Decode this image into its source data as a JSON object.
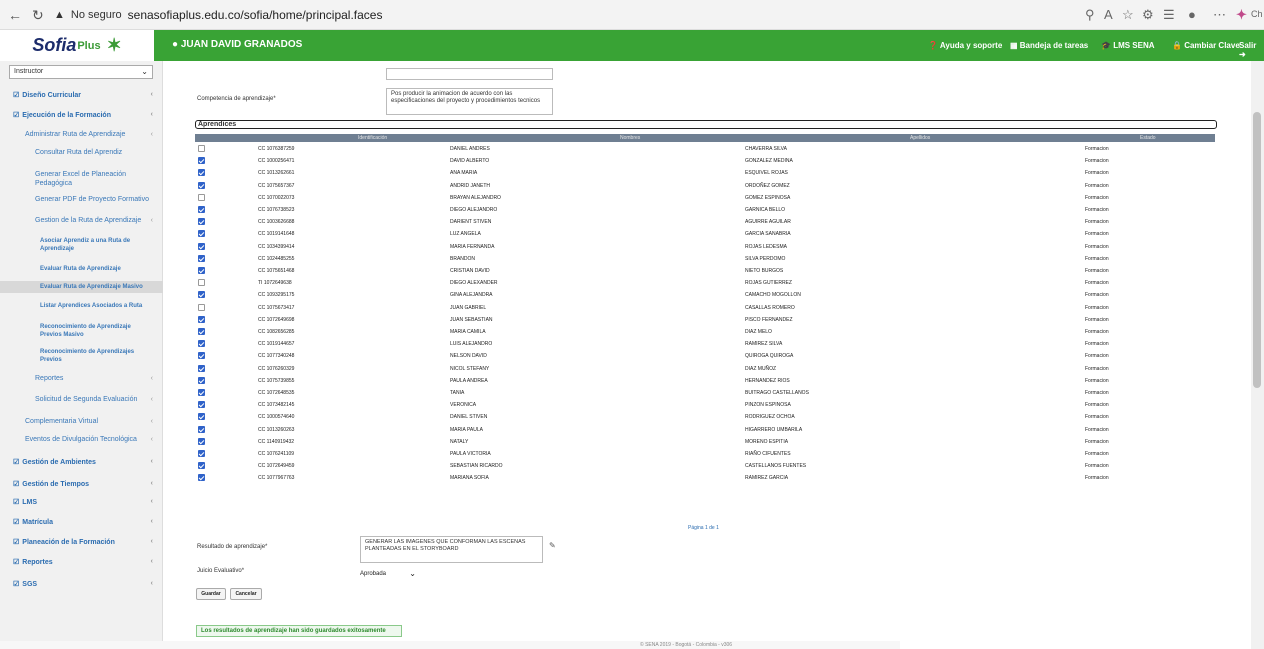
{
  "browser": {
    "security_label": "No seguro",
    "url": "senasofiaplus.edu.co/sofia/home/principal.faces",
    "profile_label": "Ch"
  },
  "header": {
    "logo_sofia": "Sofia",
    "logo_plus": "Plus",
    "user_name": "JUAN DAVID GRANADOS",
    "nav": [
      "Ayuda y soporte",
      "Bandeja de tareas",
      "LMS SENA",
      "Cambiar Clave",
      "Salir"
    ]
  },
  "sidebar": {
    "role": "Instructor",
    "items": [
      {
        "label": "Diseño Curricular",
        "level": 0
      },
      {
        "label": "Ejecución de la Formación",
        "level": 0
      },
      {
        "label": "Administrar Ruta de Aprendizaje",
        "level": 1
      },
      {
        "label": "Consultar Ruta del Aprendiz",
        "level": 2
      },
      {
        "label": "Generar Excel de Planeación Pedagógica",
        "level": 2
      },
      {
        "label": "Generar PDF de Proyecto Formativo",
        "level": 2
      },
      {
        "label": "Gestion de la Ruta de Aprendizaje",
        "level": 2
      },
      {
        "label": "Asociar Aprendiz a una Ruta de Aprendizaje",
        "level": 3
      },
      {
        "label": "Evaluar Ruta de Aprendizaje",
        "level": 3
      },
      {
        "label": "Evaluar Ruta de Aprendizaje Masivo",
        "level": 3
      },
      {
        "label": "Listar Aprendices Asociados a Ruta",
        "level": 3
      },
      {
        "label": "Reconocimiento de Aprendizaje Previos Masivo",
        "level": 3
      },
      {
        "label": "Reconocimiento de Aprendizajes Previos",
        "level": 3
      },
      {
        "label": "Reportes",
        "level": 2
      },
      {
        "label": "Solicitud de Segunda Evaluación",
        "level": 2
      },
      {
        "label": "Complementaria Virtual",
        "level": 1
      },
      {
        "label": "Eventos de Divulgación Tecnológica",
        "level": 1
      },
      {
        "label": "Gestión de Ambientes",
        "level": 0
      },
      {
        "label": "Gestión de Tiempos",
        "level": 0
      },
      {
        "label": "LMS",
        "level": 0
      },
      {
        "label": "Matrícula",
        "level": 0
      },
      {
        "label": "Planeación de la Formación",
        "level": 0
      },
      {
        "label": "Reportes",
        "level": 0
      },
      {
        "label": "SGS",
        "level": 0
      }
    ]
  },
  "form": {
    "competencia_label": "Competencia de aprendizaje*",
    "competencia_value": "Pos producir la animacion de acuerdo con las especificaciones del proyecto y procedimientos tecnicos",
    "aprendices_title": "Aprendices",
    "columns": [
      "Identificación",
      "Nombres",
      "Apellidos",
      "Estado"
    ],
    "rows": [
      {
        "checked": false,
        "id": "CC 1076387259",
        "nombres": "DANIEL ANDRES",
        "apellidos": "CHAVERRA SILVA",
        "estado": "Formacion"
      },
      {
        "checked": true,
        "id": "CC 1000256471",
        "nombres": "DAVID ALBERTO",
        "apellidos": "GONZALEZ MEDINA",
        "estado": "Formacion"
      },
      {
        "checked": true,
        "id": "CC 1013262661",
        "nombres": "ANA MARIA",
        "apellidos": "ESQUIVEL ROJAS",
        "estado": "Formacion"
      },
      {
        "checked": true,
        "id": "CC 1075657367",
        "nombres": "ANDRID JANETH",
        "apellidos": "ORDOÑEZ GOMEZ",
        "estado": "Formacion"
      },
      {
        "checked": false,
        "id": "CC 1070022073",
        "nombres": "BRAYAN ALEJANDRO",
        "apellidos": "GOMEZ ESPINOSA",
        "estado": "Formacion"
      },
      {
        "checked": true,
        "id": "CC 1076738523",
        "nombres": "DIEGO ALEJANDRO",
        "apellidos": "GARNICA BELLO",
        "estado": "Formacion"
      },
      {
        "checked": true,
        "id": "CC 1003626688",
        "nombres": "DARIENT STIVEN",
        "apellidos": "AGUIRRE AGUILAR",
        "estado": "Formacion"
      },
      {
        "checked": true,
        "id": "CC 1019141648",
        "nombres": "LUZ ANGELA",
        "apellidos": "GARCIA SANABRIA",
        "estado": "Formacion"
      },
      {
        "checked": true,
        "id": "CC 1034399414",
        "nombres": "MARIA FERNANDA",
        "apellidos": "ROJAS LEDESMA",
        "estado": "Formacion"
      },
      {
        "checked": true,
        "id": "CC 1024485255",
        "nombres": "BRANDON",
        "apellidos": "SILVA PERDOMO",
        "estado": "Formacion"
      },
      {
        "checked": true,
        "id": "CC 1075651468",
        "nombres": "CRISTIAN DAVID",
        "apellidos": "NIETO BURGOS",
        "estado": "Formacion"
      },
      {
        "checked": false,
        "id": "TI 1072649638",
        "nombres": "DIEGO ALEXANDER",
        "apellidos": "ROJAS GUTIERREZ",
        "estado": "Formacion"
      },
      {
        "checked": true,
        "id": "CC 1093295175",
        "nombres": "GINA ALEJANDRA",
        "apellidos": "CAMACHO MOGOLLON",
        "estado": "Formacion"
      },
      {
        "checked": false,
        "id": "CC 1075673417",
        "nombres": "JUAN GABRIEL",
        "apellidos": "CASALLAS ROMERO",
        "estado": "Formacion"
      },
      {
        "checked": true,
        "id": "CC 1072649698",
        "nombres": "JUAN SEBASTIAN",
        "apellidos": "PISCO FERNANDEZ",
        "estado": "Formacion"
      },
      {
        "checked": true,
        "id": "CC 1082656285",
        "nombres": "MARIA CAMILA",
        "apellidos": "DIAZ MELO",
        "estado": "Formacion"
      },
      {
        "checked": true,
        "id": "CC 1019144657",
        "nombres": "LUIS ALEJANDRO",
        "apellidos": "RAMIREZ SILVA",
        "estado": "Formacion"
      },
      {
        "checked": true,
        "id": "CC 1077340248",
        "nombres": "NELSON DAVID",
        "apellidos": "QUIROGA QUIROGA",
        "estado": "Formacion"
      },
      {
        "checked": true,
        "id": "CC 1076260329",
        "nombres": "NICOL STEFANY",
        "apellidos": "DIAZ MUÑOZ",
        "estado": "Formacion"
      },
      {
        "checked": true,
        "id": "CC 1075739855",
        "nombres": "PAULA ANDREA",
        "apellidos": "HERNANDEZ RIOS",
        "estado": "Formacion"
      },
      {
        "checked": true,
        "id": "CC 1072648535",
        "nombres": "TANIA",
        "apellidos": "BUITRAGO CASTELLANOS",
        "estado": "Formacion"
      },
      {
        "checked": true,
        "id": "CC 1073482145",
        "nombres": "VERONICA",
        "apellidos": "PINZON ESPINOSA",
        "estado": "Formacion"
      },
      {
        "checked": true,
        "id": "CC 1000574640",
        "nombres": "DANIEL STIVEN",
        "apellidos": "RODRIGUEZ OCHOA",
        "estado": "Formacion"
      },
      {
        "checked": true,
        "id": "CC 1013260263",
        "nombres": "MARIA PAULA",
        "apellidos": "HIGARRERO UMBARILA",
        "estado": "Formacion"
      },
      {
        "checked": true,
        "id": "CC 1140919432",
        "nombres": "NATALY",
        "apellidos": "MORENO ESPITIA",
        "estado": "Formacion"
      },
      {
        "checked": true,
        "id": "CC 1076241109",
        "nombres": "PAULA VICTORIA",
        "apellidos": "RIAÑO CIFUENTES",
        "estado": "Formacion"
      },
      {
        "checked": true,
        "id": "CC 1072649459",
        "nombres": "SEBASTIAN RICARDO",
        "apellidos": "CASTELLANOS FUENTES",
        "estado": "Formacion"
      },
      {
        "checked": true,
        "id": "CC 1077967763",
        "nombres": "MARIANA SOFIA",
        "apellidos": "RAMIREZ GARCIA",
        "estado": "Formacion"
      }
    ],
    "pager": "Página 1 de 1",
    "resultado_label": "Resultado de aprendizaje*",
    "resultado_value": "GENERAR LAS IMAGENES QUE CONFORMAN LAS ESCENAS PLANTEADAS EN EL STORYBOARD",
    "juicio_label": "Juicio Evaluativo*",
    "juicio_value": "Aprobada",
    "save_label": "Guardar",
    "cancel_label": "Cancelar",
    "success_message": "Los resultados de aprendizaje han sido guardados exitosamente"
  },
  "footer": {
    "copyright": "© SENA 2019 - Bogotá - Colombia - v306"
  }
}
